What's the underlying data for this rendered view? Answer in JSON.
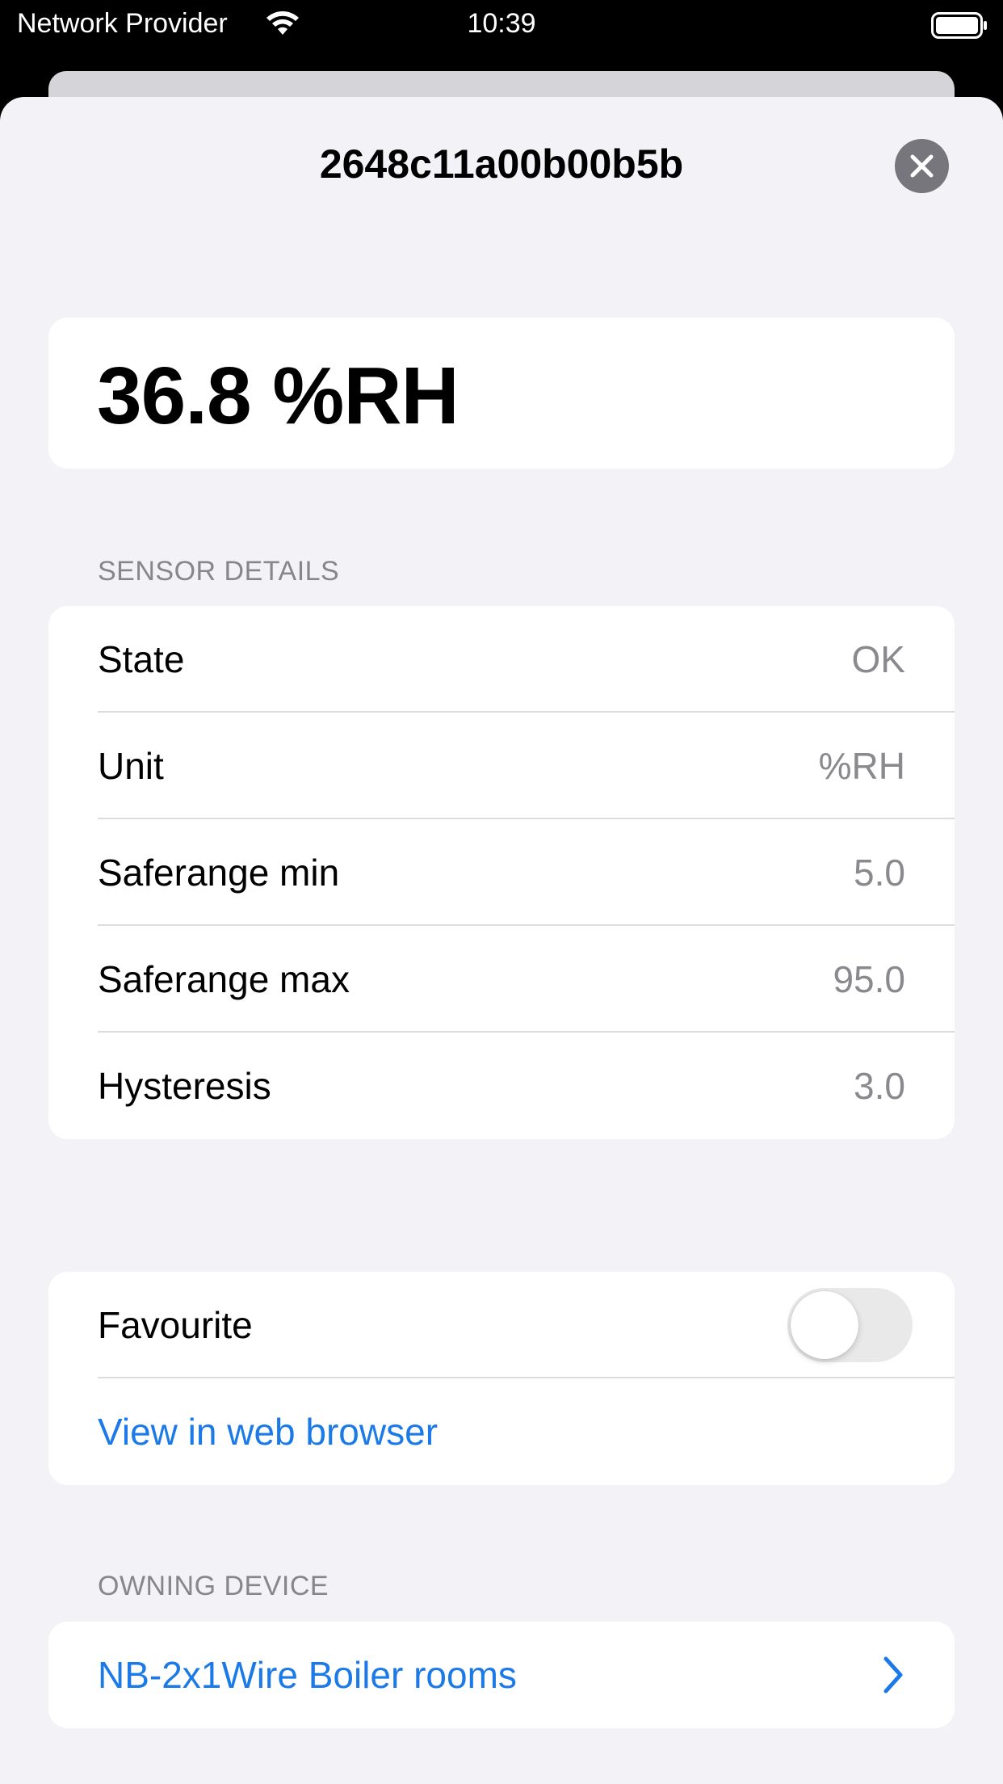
{
  "status_bar": {
    "carrier": "Network Provider",
    "time": "10:39",
    "wifi_icon": "wifi-icon",
    "battery_icon": "battery-full-icon"
  },
  "sheet": {
    "title": "2648c11a00b00b5b",
    "close_icon": "close-icon"
  },
  "reading": {
    "value": "36.8 %RH"
  },
  "sensor_details": {
    "header": "SENSOR DETAILS",
    "rows": [
      {
        "label": "State",
        "value": "OK"
      },
      {
        "label": "Unit",
        "value": "%RH"
      },
      {
        "label": "Saferange min",
        "value": "5.0"
      },
      {
        "label": "Saferange max",
        "value": "95.0"
      },
      {
        "label": "Hysteresis",
        "value": "3.0"
      }
    ]
  },
  "actions": {
    "favourite_label": "Favourite",
    "favourite_on": false,
    "web_link": "View in web browser"
  },
  "owning_device": {
    "header": "OWNING DEVICE",
    "name": "NB-2x1Wire Boiler rooms",
    "chevron_icon": "chevron-right-icon"
  },
  "colors": {
    "link": "#1b7ae8",
    "sheet_background": "#f2f2f7",
    "secondary_text": "#8a8a8e"
  }
}
